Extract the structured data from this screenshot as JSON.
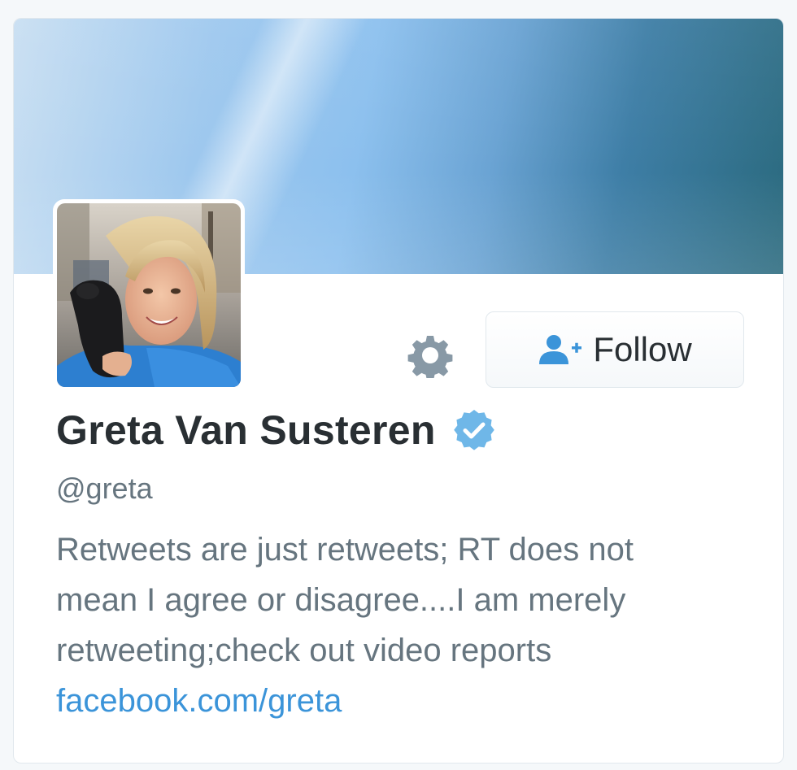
{
  "profile": {
    "name": "Greta Van Susteren",
    "handle": "@greta",
    "bio_lines": [
      "Retweets are just retweets; RT does not",
      "mean I agree or disagree....I am merely",
      "retweeting;check out video reports"
    ],
    "link": "facebook.com/greta",
    "verified": true
  },
  "actions": {
    "follow_label": "Follow",
    "settings_icon": "gear-icon",
    "follow_icon": "add-user-icon"
  },
  "colors": {
    "name": "#292f33",
    "secondary_text": "#66757f",
    "link": "#3b94d9",
    "verified_badge": "#6fb7e8",
    "follow_icon": "#3b94d9"
  }
}
